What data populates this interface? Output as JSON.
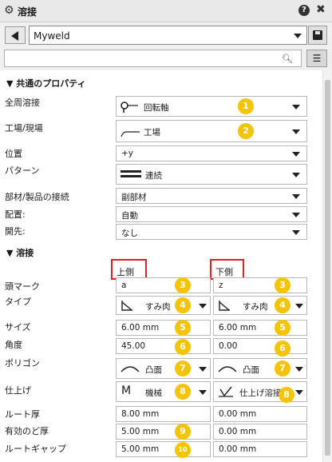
{
  "titlebar": {
    "title": "溶接",
    "help": "?",
    "close": "✖"
  },
  "preset": {
    "value": "Myweld"
  },
  "search": {
    "placeholder": "",
    "icon": "search-icon"
  },
  "sections": {
    "common": "▼ 共通のプロパティ",
    "weld": "▼ 溶接"
  },
  "common": {
    "all_around_label": "全周溶接",
    "all_around_value": "回転軸",
    "shop_label": "工場/現場",
    "shop_value": "工場",
    "position_label": "位置",
    "position_value": "+y",
    "pattern_label": "パターン",
    "pattern_value": "連続",
    "connect_label": "部材/製品の接続",
    "connect_value": "副部材",
    "placement_label": "配置:",
    "placement_value": "自動",
    "lead_label": "開先:",
    "lead_value": "なし"
  },
  "weld": {
    "upper_header": "上側",
    "lower_header": "下側",
    "head_mark_label": "頭マーク",
    "upper_head_mark": "a",
    "lower_head_mark": "z",
    "type_label": "タイプ",
    "upper_type": "すみ肉",
    "lower_type": "すみ肉",
    "size_label": "サイズ",
    "upper_size": "6.00 mm",
    "lower_size": "6.00 mm",
    "angle_label": "角度",
    "upper_angle": "45.00",
    "lower_angle": "0.00",
    "polygon_label": "ポリゴン",
    "upper_polygon": "凸面",
    "lower_polygon": "凸面",
    "finish_label": "仕上げ",
    "upper_finish": "機械",
    "lower_finish": "仕上げ溶接",
    "root_thickness_label": "ルート厚",
    "upper_root_thickness": "8.00 mm",
    "lower_root_thickness": "0.00 mm",
    "throat_label": "有効のど厚",
    "upper_throat": "5.00 mm",
    "lower_throat": "0.00 mm",
    "root_gap_label": "ルートギャップ",
    "upper_root_gap": "5.00 mm",
    "lower_root_gap": "0.00 mm"
  },
  "badges": {
    "b1": "1",
    "b2": "2",
    "b3": "3",
    "b4": "4",
    "b5": "5",
    "b6": "6",
    "b7": "7",
    "b8": "8",
    "b9": "9",
    "b10": "10"
  },
  "colors": {
    "badge": "#f5c400",
    "highlight_box": "#e02020"
  }
}
